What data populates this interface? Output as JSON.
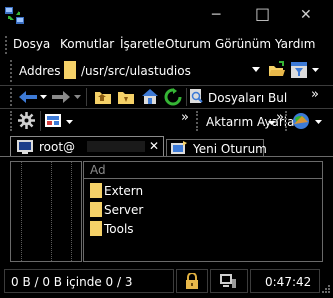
{
  "window": {
    "title": "",
    "minimize_glyph": "─",
    "maximize_glyph": "□",
    "close_glyph": "✕"
  },
  "menu": [
    {
      "label": "Dosya"
    },
    {
      "label": "Komutlar"
    },
    {
      "label": "İşaretle"
    },
    {
      "label": "Oturum"
    },
    {
      "label": "Görünüm"
    },
    {
      "label": "Yardım"
    }
  ],
  "address_bar": {
    "label": "Addres",
    "path": "/usr/src/ulastudios"
  },
  "toolbar": {
    "find_files_label": "Dosyaları Bul",
    "transfer_settings_label": "Aktarım Ayarları",
    "overflow_glyph": "»"
  },
  "tabs": [
    {
      "label": "root@"
    },
    {
      "label": "Yeni Oturum"
    }
  ],
  "file_list": {
    "column_header": "Ad",
    "items": [
      {
        "name": "Extern"
      },
      {
        "name": "Server"
      },
      {
        "name": "Tools"
      }
    ]
  },
  "status_bar": {
    "selection_text": "0 B / 0 B içinde 0 / 3",
    "time": "0:47:42"
  },
  "colors": {
    "background": "#000000",
    "folder": "#f5d168",
    "accent_blue": "#3d7ad6",
    "green": "#35b535",
    "orange": "#e8952a"
  }
}
